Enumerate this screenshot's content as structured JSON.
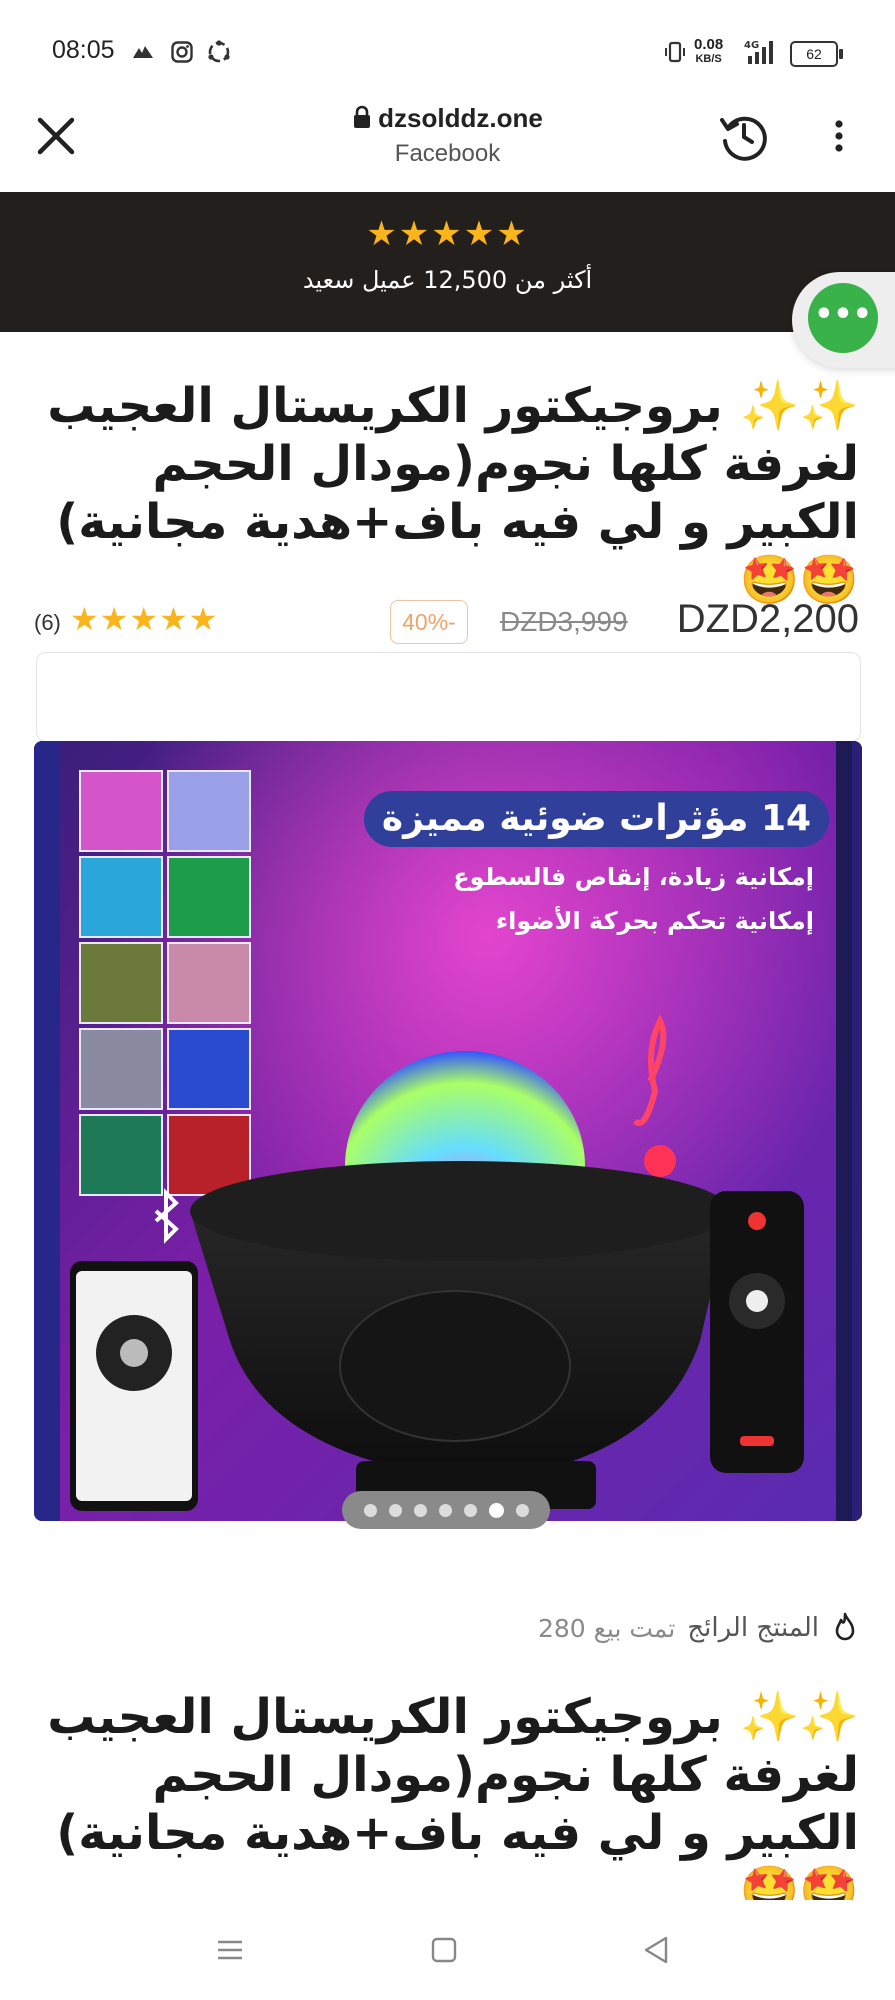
{
  "status_bar": {
    "time": "08:05",
    "net_speed_value": "0.08",
    "net_speed_unit": "KB/S",
    "network": "4G",
    "battery": "62"
  },
  "browser": {
    "url": "dzsolddz.one",
    "source": "Facebook"
  },
  "banner": {
    "stars": "★★★★★",
    "text": "أكثر من 12,500 عميل سعيد"
  },
  "product": {
    "title": "✨✨ بروجيكتور الكريستال العجيب لغرفة كلها نجوم(مودال الحجم الكبير و لي فيه باف+هدية مجانية)🤩🤩",
    "price_current": "DZD2,200",
    "price_old": "DZD3,999",
    "discount": "40%-",
    "rating_stars": "★★★★★",
    "rating_count": "(6)"
  },
  "image": {
    "headline": "14 مؤثرات ضوئية مميزة",
    "line1": "إمكانية زيادة، إنقاص فالسطوع",
    "line2": "إمكانية تحكم بحركة الأضواء",
    "dots_total": 7,
    "dots_active_index": 5
  },
  "trending": {
    "label": "المنتج الرائج",
    "sold": "تمت بيع 280"
  },
  "colors": {
    "banner_bg": "#231f1c",
    "star": "#f9b51b",
    "chat_green": "#3ab24a",
    "discount": "#f2a468"
  }
}
